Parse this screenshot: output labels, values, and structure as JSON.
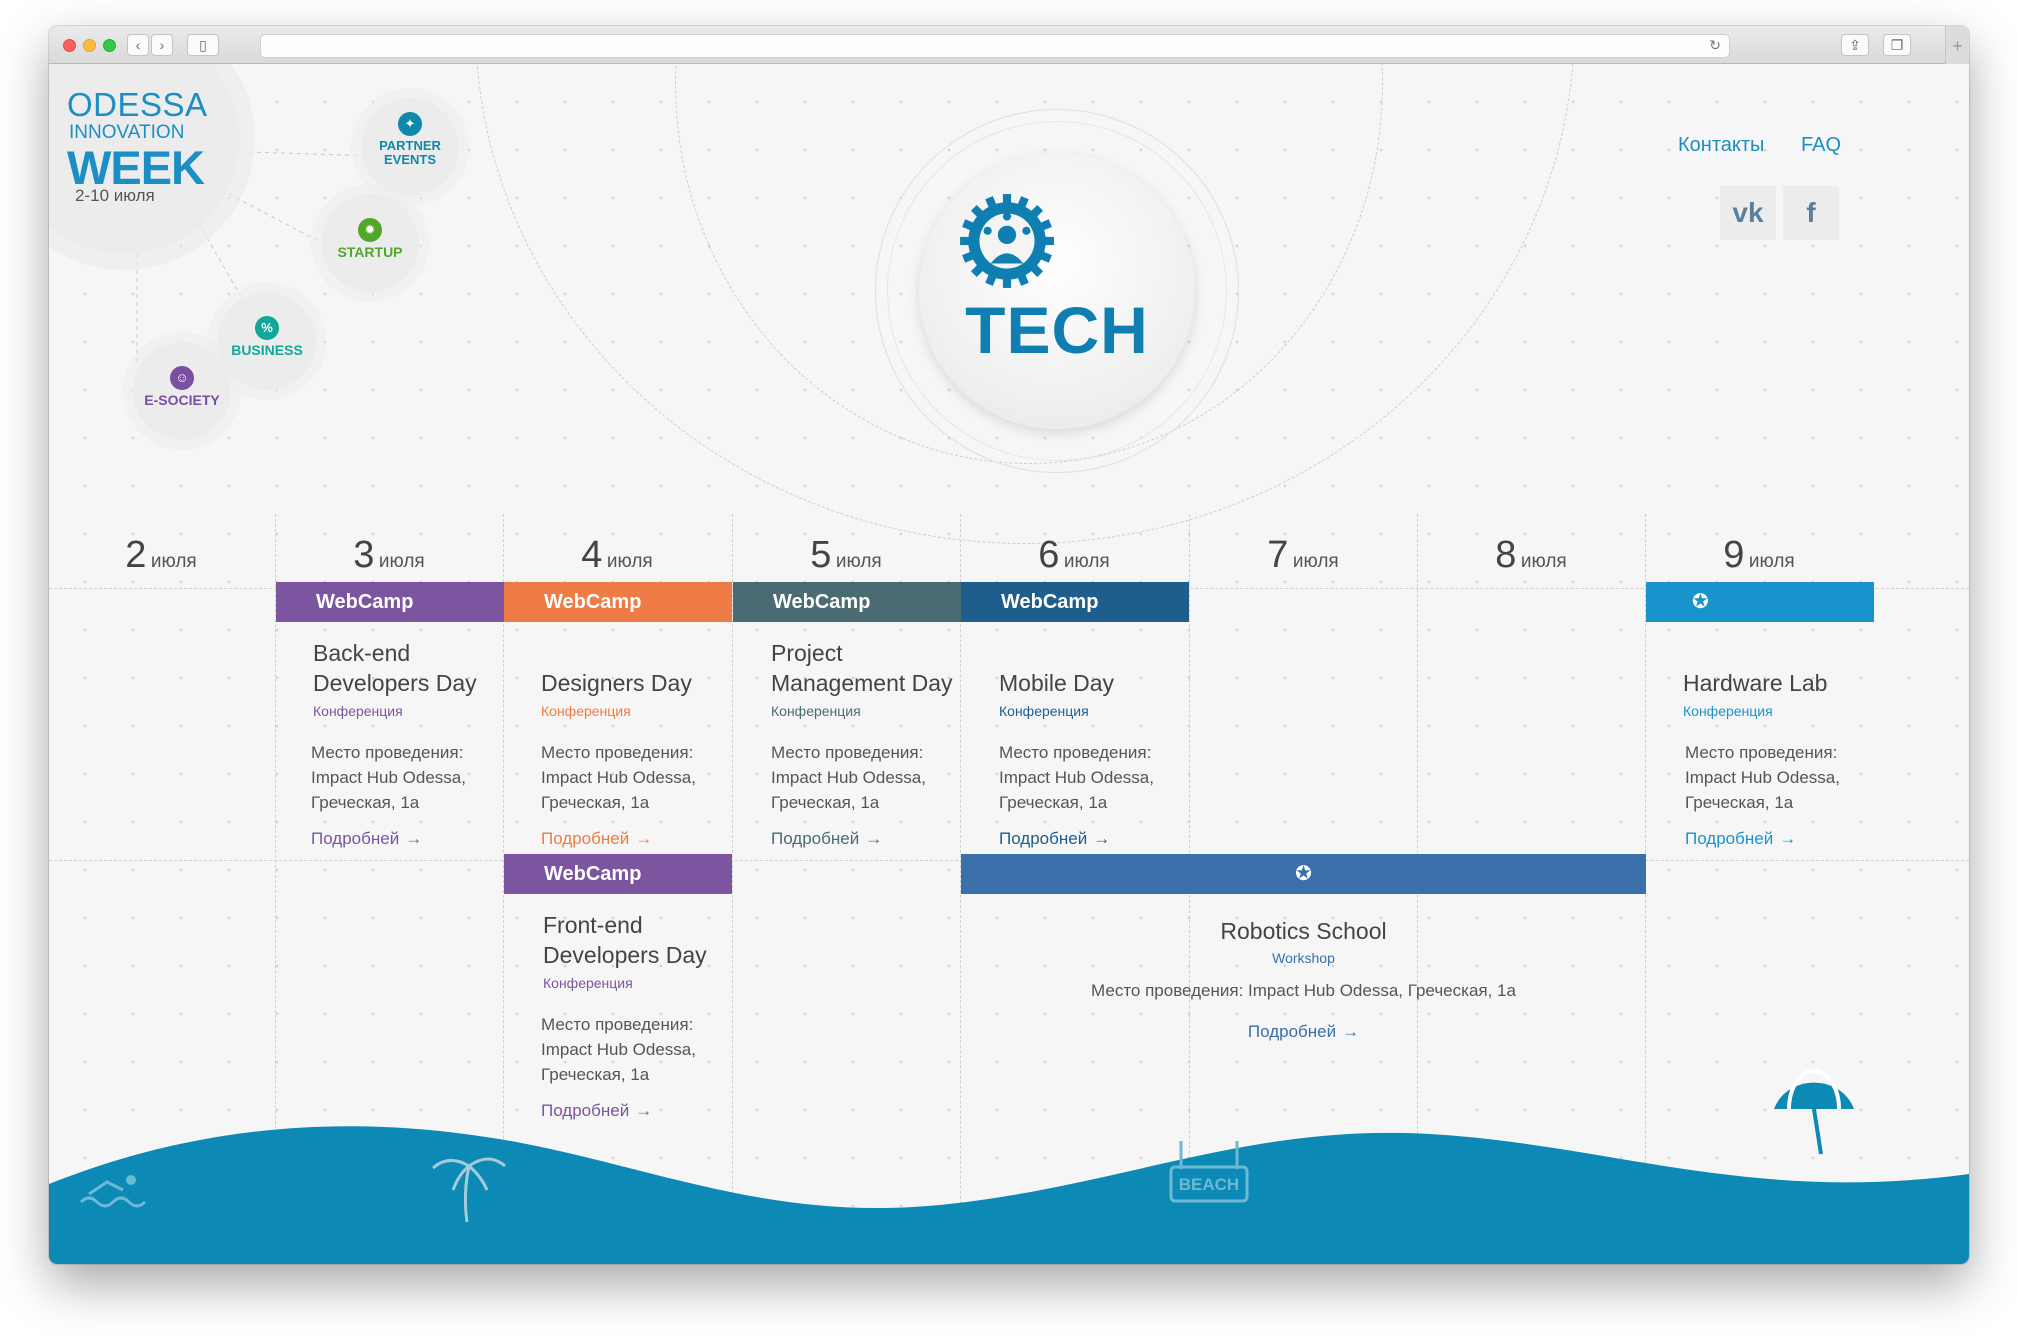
{
  "logo": {
    "line1": "ODESSA",
    "line2": "INNOVATION",
    "line3": "WEEK",
    "dates": "2-10 июля"
  },
  "categories": {
    "partner": {
      "label_1": "PARTNER",
      "label_2": "EVENTS",
      "color": "#0d8aa9"
    },
    "startup": {
      "label": "STARTUP",
      "color": "#52a62a"
    },
    "business": {
      "label": "BUSINESS",
      "color": "#12a79b"
    },
    "esociety": {
      "label": "E-SOCIETY",
      "color": "#7a4ea0"
    }
  },
  "tech": {
    "title": "TECH",
    "color": "#0f7fb1"
  },
  "nav": {
    "contacts": "Контакты",
    "faq": "FAQ"
  },
  "social": {
    "vk": "vk",
    "fb": "f"
  },
  "days": [
    {
      "n": "2",
      "m": "июля"
    },
    {
      "n": "3",
      "m": "июля"
    },
    {
      "n": "4",
      "m": "июля"
    },
    {
      "n": "5",
      "m": "июля"
    },
    {
      "n": "6",
      "m": "июля"
    },
    {
      "n": "7",
      "m": "июля"
    },
    {
      "n": "8",
      "m": "июля"
    },
    {
      "n": "9",
      "m": "июля"
    }
  ],
  "brand": {
    "webcamp": "WebCamp"
  },
  "events": [
    {
      "title_1": "Back-end",
      "title_2": "Developers Day",
      "type": "Конференция",
      "place_1": "Место проведения:",
      "place_2": "Impact Hub Odessa,",
      "place_3": "Греческая, 1а",
      "more": "Подробней",
      "color": "#7b55a0"
    },
    {
      "title_1": "",
      "title_2": "Designers Day",
      "type": "Конференция",
      "place_1": "Место проведения:",
      "place_2": "Impact Hub Odessa,",
      "place_3": "Греческая, 1а",
      "more": "Подробней",
      "color": "#ef7b45"
    },
    {
      "title_1": "Project",
      "title_2": "Management Day",
      "type": "Конференция",
      "place_1": "Место проведения:",
      "place_2": "Impact Hub Odessa,",
      "place_3": "Греческая, 1а",
      "more": "Подробней",
      "color": "#4a6b71"
    },
    {
      "title_1": "",
      "title_2": "Mobile Day",
      "type": "Конференция",
      "place_1": "Место проведения:",
      "place_2": "Impact Hub Odessa,",
      "place_3": "Греческая, 1а",
      "more": "Подробней",
      "color": "#1e5d8c"
    },
    {
      "title_1": "",
      "title_2": "Hardware Lab",
      "type": "Конференция",
      "place_1": "Место проведения:",
      "place_2": "Impact Hub Odessa,",
      "place_3": "Греческая, 1а",
      "more": "Подробней",
      "color": "#1893cc"
    },
    {
      "title_1": "Front-end",
      "title_2": "Developers Day",
      "type": "Конференция",
      "place_1": "Место проведения:",
      "place_2": "Impact Hub Odessa,",
      "place_3": "Греческая, 1а",
      "more": "Подробней",
      "color": "#7b55a0"
    }
  ],
  "robotics": {
    "title": "Robotics School",
    "type": "Workshop",
    "place": "Место проведения: Impact Hub Odessa, Греческая, 1а",
    "more": "Подробней",
    "color": "#3a6fac"
  },
  "footer": {
    "beach": "BEACH",
    "wave_color": "#0d89b5"
  }
}
